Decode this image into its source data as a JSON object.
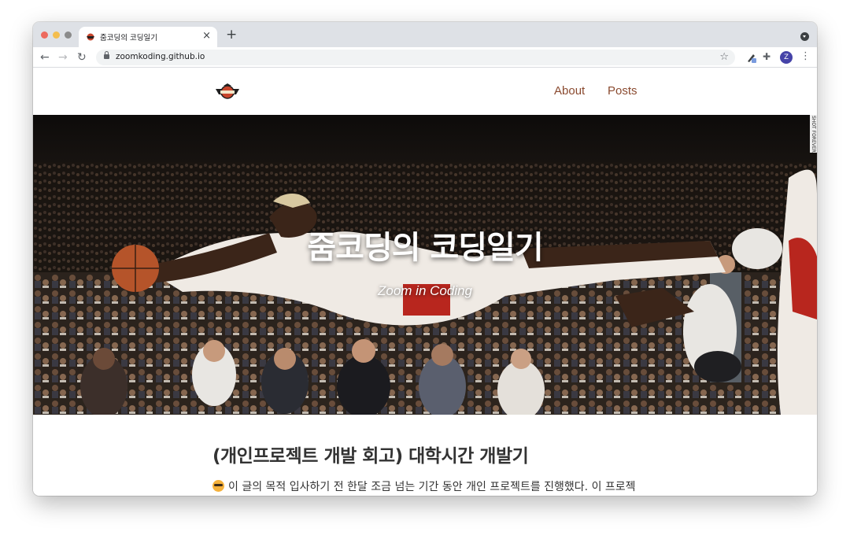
{
  "browser": {
    "tab_title": "줌코딩의 코딩일기",
    "tab_close": "×",
    "new_tab": "+",
    "url": "zoomkoding.github.io",
    "avatar_letter": "Z",
    "icons": [
      "back-arrow-icon",
      "forward-arrow-icon",
      "reload-icon",
      "lock-icon",
      "star-icon",
      "pen-extension-icon",
      "puzzle-icon",
      "kebab-menu-icon"
    ]
  },
  "site": {
    "nav": {
      "about": "About",
      "posts": "Posts"
    },
    "hero": {
      "title": "줌코딩의 코딩일기",
      "subtitle": "Zoom in Coding",
      "credit": "SHOT FOREVER"
    }
  },
  "post": {
    "title": "(개인프로젝트 개발 회고) 대학시간 개발기",
    "excerpt": "이 글의 목적 입사하기 전 한달 조금 넘는 기간 동안 개인 프로젝트를 진행했다. 이 프로젝"
  },
  "colors": {
    "nav_link": "#8a4a2f",
    "tabstrip": "#dee1e6",
    "avatar": "#4543a8"
  }
}
